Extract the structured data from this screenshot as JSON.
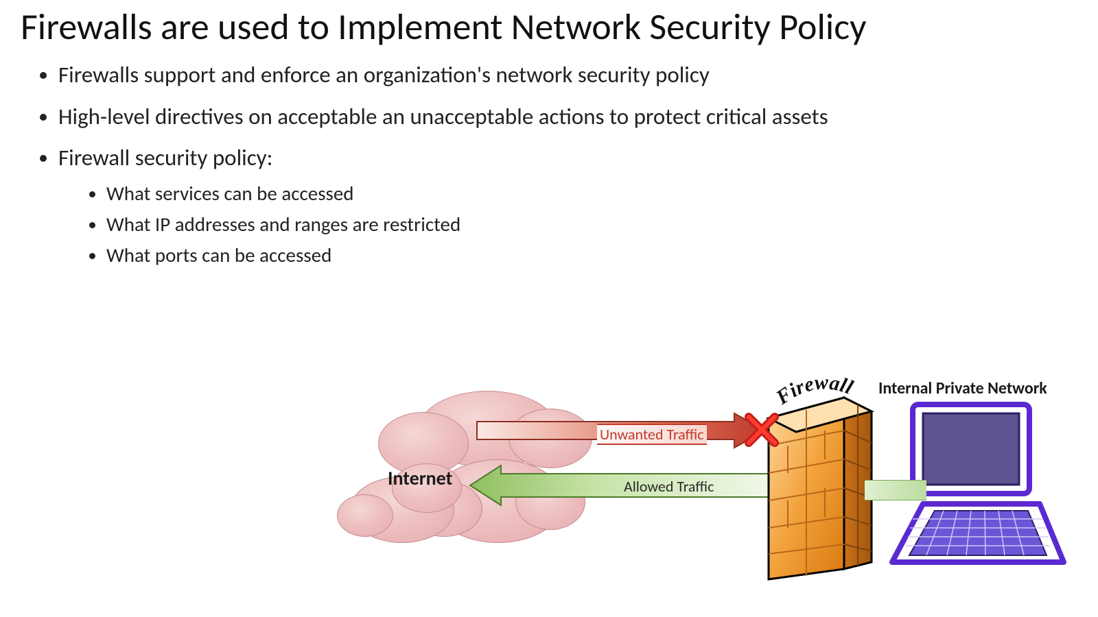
{
  "title": "Firewalls are used to Implement Network Security Policy",
  "bullets": {
    "b1": "Firewalls support and enforce an organization's network security policy",
    "b2": "High-level directives on acceptable an unacceptable actions to protect critical assets",
    "b3": "Firewall security policy:",
    "sub1": "What services can be accessed",
    "sub2": "What IP addresses and ranges are restricted",
    "sub3": "What ports can be accessed"
  },
  "diagram": {
    "internet_label": "Internet",
    "unwanted_label": "Unwanted Traffic",
    "allowed_label": "Allowed Traffic",
    "firewall_label": "Firewall",
    "internal_label": "Internal Private Network"
  }
}
